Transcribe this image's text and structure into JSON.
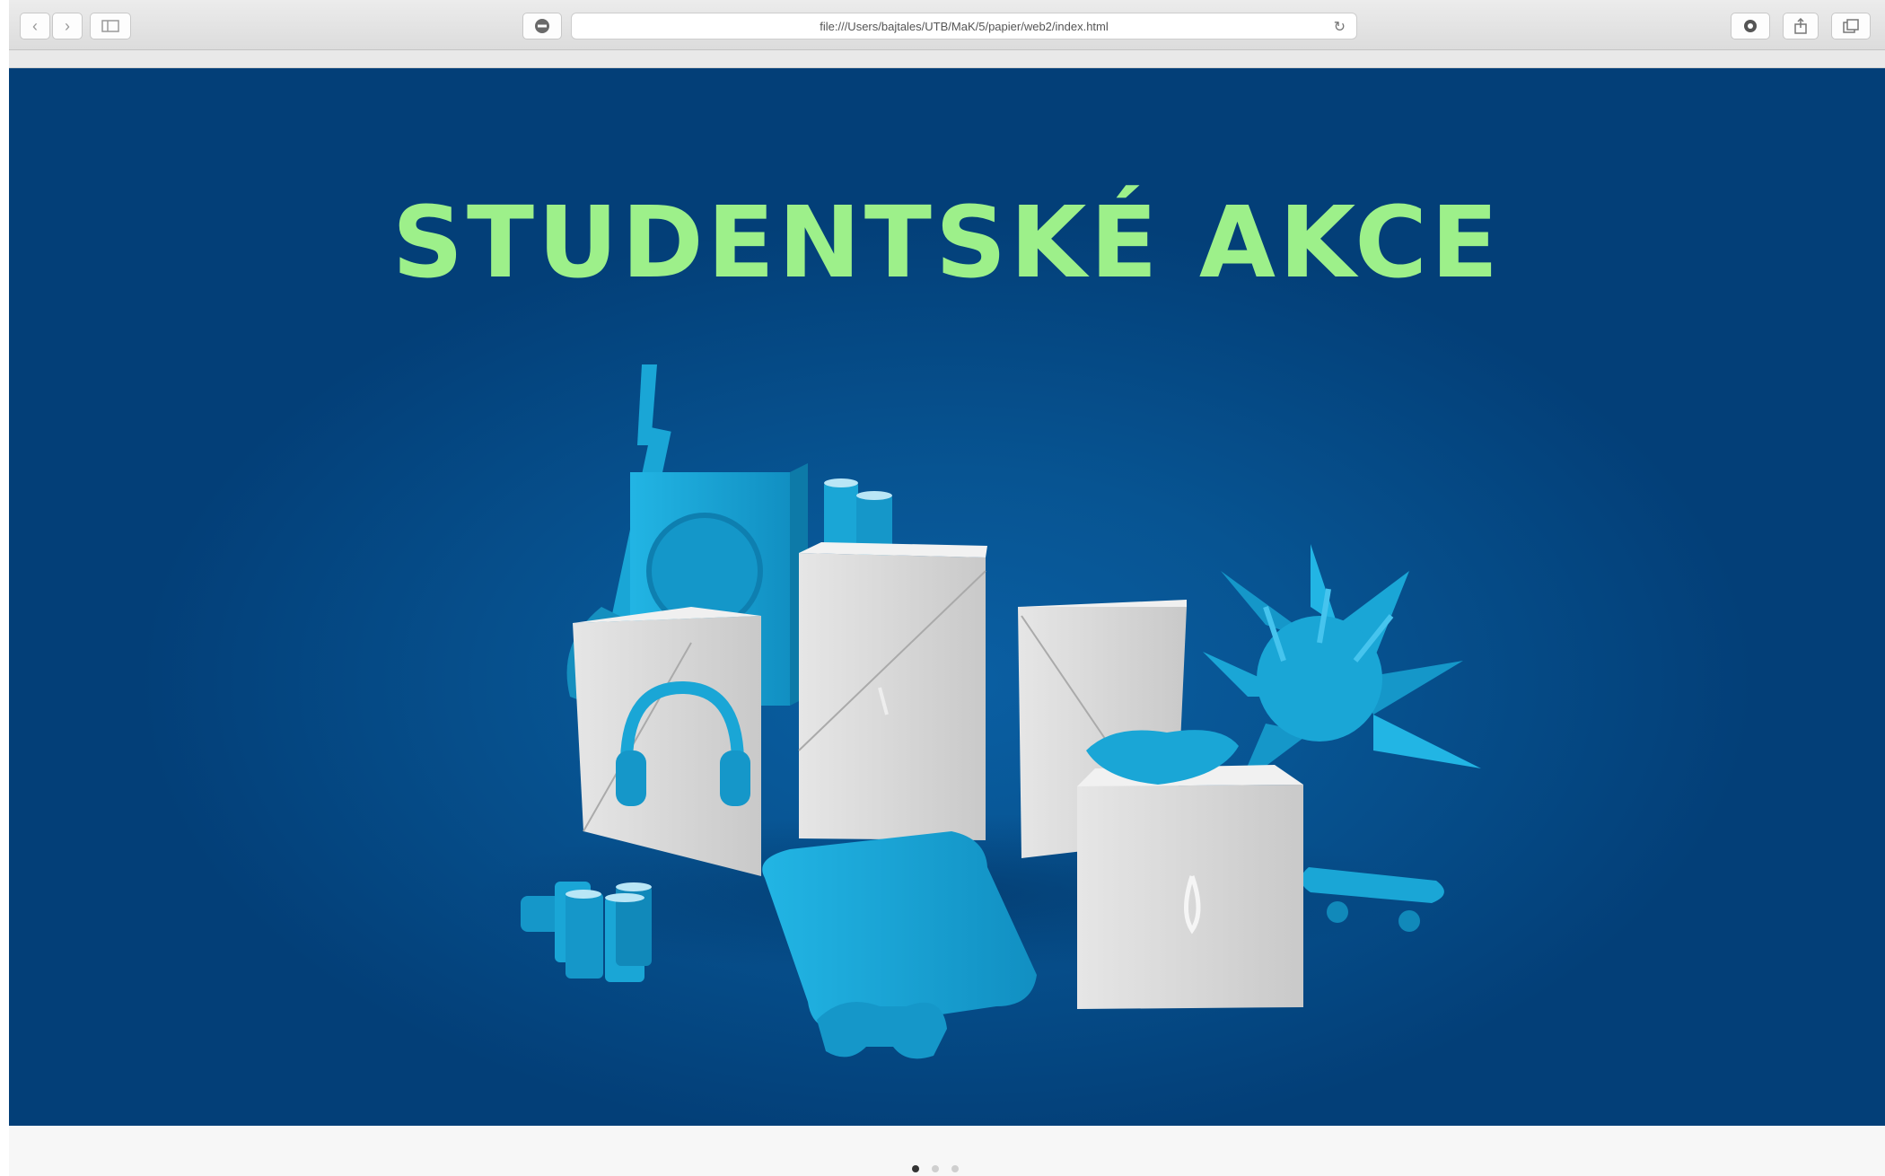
{
  "browser": {
    "url": "file:///Users/bajtales/UTB/MaK/5/papier/web2/index.html",
    "icons": {
      "back": "chevron-left-icon",
      "forward": "chevron-right-icon",
      "sidebar": "sidebar-icon",
      "adblock": "adblock-icon",
      "reload": "reload-icon",
      "extension": "extension-icon",
      "share": "share-icon",
      "tabs": "tabs-icon"
    }
  },
  "hero": {
    "title": "STUDENTSKÉ AKCE",
    "background": "#065496",
    "title_color": "#9df08a",
    "object_color": "#1aa6d6",
    "box_color": "#d8d8d8"
  },
  "carousel": {
    "slide_count": 3,
    "active_index": 0
  }
}
